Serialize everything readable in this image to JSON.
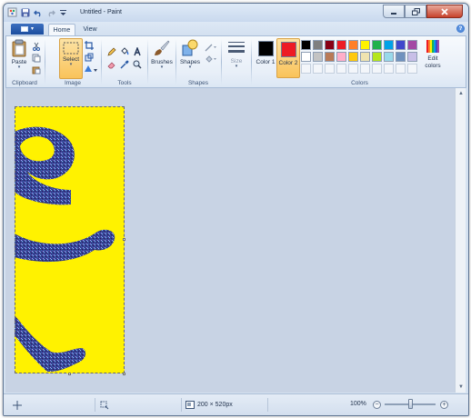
{
  "window": {
    "title": "Untitled - Paint",
    "caption": {
      "minimize_icon": "minimize-icon",
      "maximize_icon": "maximize-icon",
      "close_icon": "close-icon"
    }
  },
  "quick_access": [
    "paint-app-icon",
    "save-icon",
    "undo-icon",
    "redo-icon",
    "customize-qat-icon"
  ],
  "tabs": [
    {
      "label": "Home",
      "active": true
    },
    {
      "label": "View",
      "active": false
    }
  ],
  "ribbon": {
    "clipboard": {
      "label": "Clipboard",
      "paste_label": "Paste"
    },
    "image": {
      "label": "Image",
      "select_label": "Select"
    },
    "tools": {
      "label": "Tools"
    },
    "brushes": {
      "label": "Brushes"
    },
    "shapes": {
      "label": "Shapes",
      "shapes_label": "Shapes"
    },
    "size": {
      "label": "Size"
    },
    "colors": {
      "label": "Colors",
      "color1_label": "Color 1",
      "color2_label": "Color 2",
      "edit_label": "Edit colors",
      "color1": "#000000",
      "color2": "#ed1c24",
      "palette_row1": [
        "#000000",
        "#7f7f7f",
        "#880015",
        "#ed1c24",
        "#ff7f27",
        "#fff200",
        "#22b14c",
        "#00a2e8",
        "#3f48cc",
        "#a349a4"
      ],
      "palette_row2": [
        "#ffffff",
        "#c3c3c3",
        "#b97a57",
        "#ffaec9",
        "#ffc90e",
        "#efe4b0",
        "#b5e61d",
        "#99d9ea",
        "#7092be",
        "#c8bfe7"
      ]
    }
  },
  "canvas": {
    "background": "#fff200",
    "glyph_color": "#3a3f8f"
  },
  "statusbar": {
    "image_size": "200 × 520px",
    "zoom": "100%",
    "zoom_level": 1.0
  }
}
